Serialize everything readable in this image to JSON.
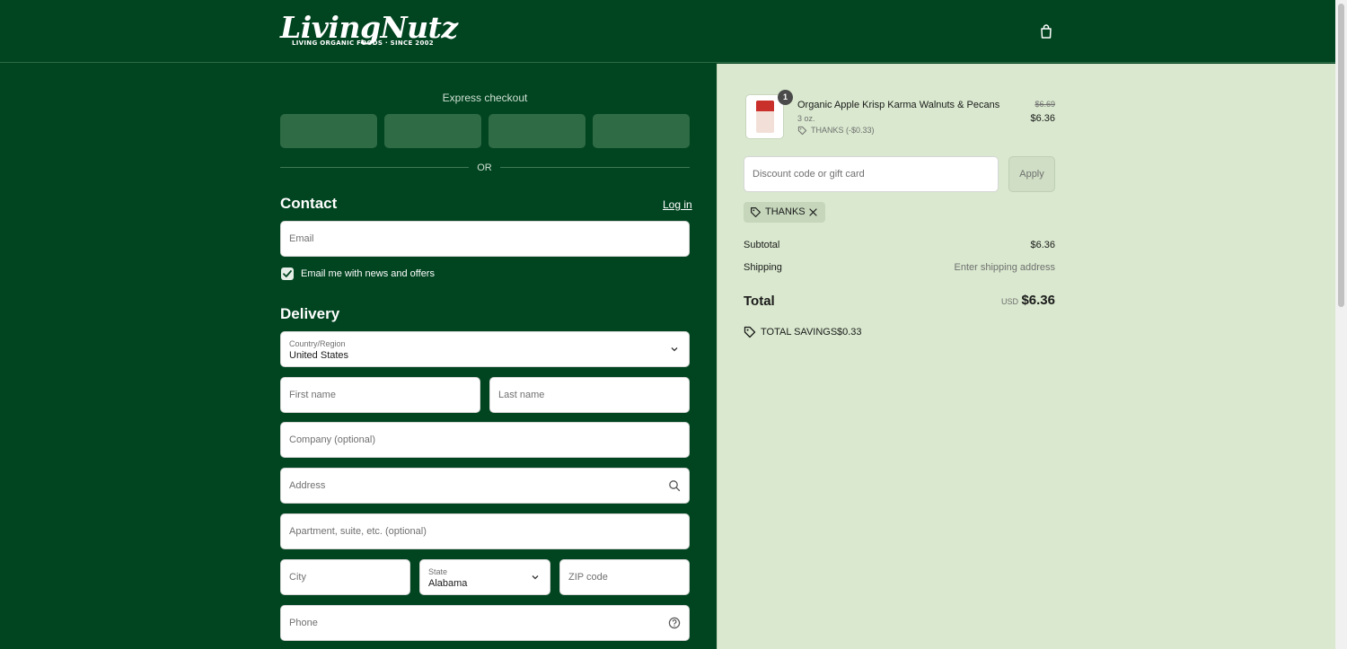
{
  "brand": {
    "name": "LivingNutz",
    "tagline": "LIVING ORGANIC FOODS · SINCE 2002"
  },
  "express": {
    "title": "Express checkout",
    "or_text": "OR"
  },
  "contact": {
    "title": "Contact",
    "login_label": "Log in",
    "email_placeholder": "Email",
    "newsletter_label": "Email me with news and offers",
    "newsletter_checked": true
  },
  "delivery": {
    "title": "Delivery",
    "country_label": "Country/Region",
    "country_value": "United States",
    "first_name_placeholder": "First name",
    "last_name_placeholder": "Last name",
    "company_placeholder": "Company (optional)",
    "address_placeholder": "Address",
    "apartment_placeholder": "Apartment, suite, etc. (optional)",
    "city_placeholder": "City",
    "state_label": "State",
    "state_value": "Alabama",
    "zip_placeholder": "ZIP code",
    "phone_placeholder": "Phone"
  },
  "order": {
    "item": {
      "quantity": "1",
      "name": "Organic Apple Krisp Karma Walnuts & Pecans",
      "variant": "3 oz.",
      "discount_note": "THANKS (-$0.33)",
      "original_price": "$6.69",
      "price": "$6.36"
    },
    "discount_placeholder": "Discount code or gift card",
    "apply_label": "Apply",
    "applied_code": "THANKS",
    "subtotal_label": "Subtotal",
    "subtotal_value": "$6.36",
    "shipping_label": "Shipping",
    "shipping_value": "Enter shipping address",
    "total_label": "Total",
    "total_currency": "USD",
    "total_value": "$6.36",
    "savings_label": "TOTAL SAVINGS",
    "savings_value": "$0.33"
  },
  "colors": {
    "primary_green": "#004420",
    "sidebar_bg": "#d9e8ce",
    "button_green": "#2f6b45"
  }
}
